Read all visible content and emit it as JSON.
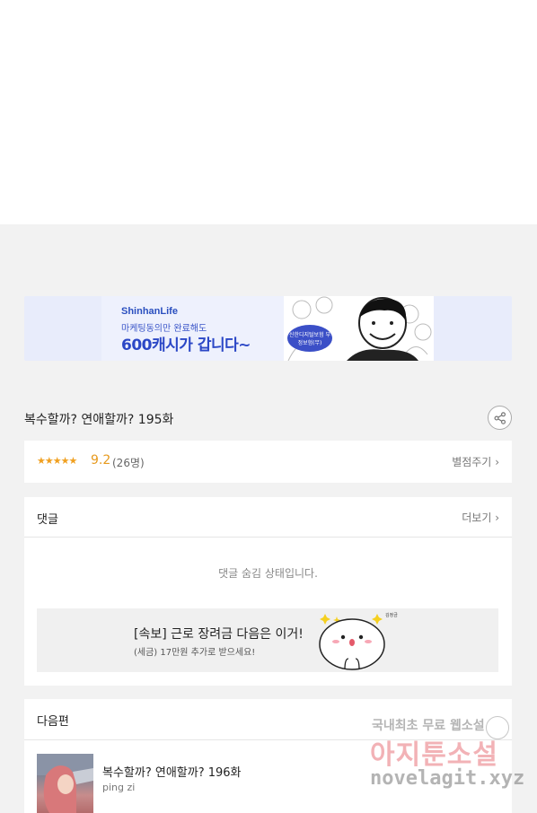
{
  "banner": {
    "brand": "ShinhanLife",
    "subtitle": "마케팅동의만 완료해도",
    "headline": "600캐시가 갑니다~",
    "badge": "신한디지털보험 부정보험(무)"
  },
  "episode": {
    "title": "복수할까? 연애할까? 195화",
    "share_icon": "share-icon"
  },
  "rating": {
    "stars": "★★★★★",
    "score": "9.2",
    "count": "(26명)",
    "rate_link": "별점주기"
  },
  "comments": {
    "label": "댓글",
    "more": "더보기",
    "hidden_message": "댓글 숨김 상태입니다.",
    "ad": {
      "title": "[속보] 근로 장려금 다음은 이거!",
      "subtitle": "(세금) 17만원 추가로 받으세요!",
      "mascot_tag": "김정금"
    }
  },
  "next": {
    "label": "다음편",
    "title": "복수할까? 연애할까? 196화",
    "author": "ping zi"
  },
  "watermark": {
    "line1": "국내최초 무료 웹소설",
    "line2": "아지툰소설",
    "line3": "novelagit.xyz"
  },
  "colors": {
    "accent_star": "#f0a020",
    "banner_blue": "#2b47c6",
    "watermark_pink": "#e8747c"
  }
}
